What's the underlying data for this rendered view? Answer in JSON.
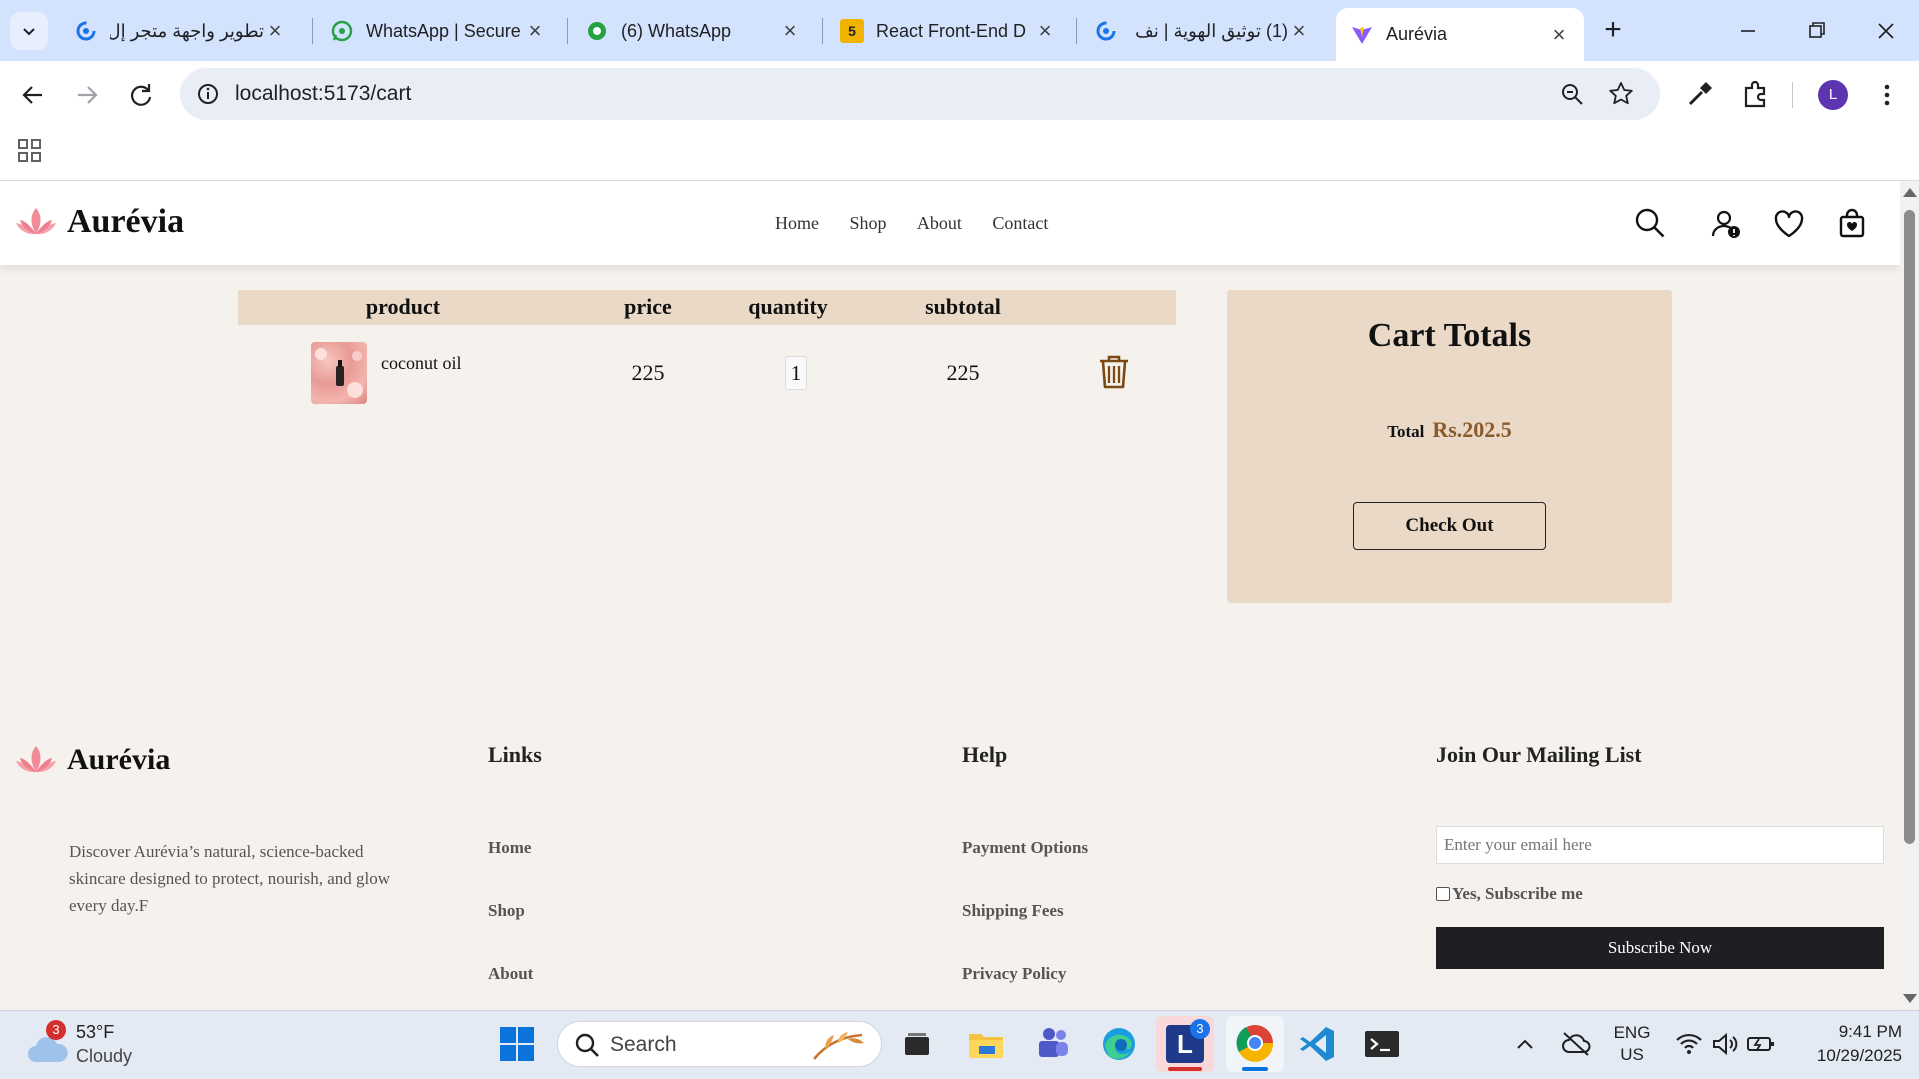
{
  "browser": {
    "tabs": [
      {
        "title": "تطوير واجهة متجر إل",
        "favicon": "blue-refresh-logo",
        "active": false
      },
      {
        "title": "WhatsApp | Secure",
        "favicon": "whatsapp-logo",
        "active": false
      },
      {
        "title": "(6) WhatsApp",
        "favicon": "whatsapp-logo",
        "active": false
      },
      {
        "title": "React Front-End D",
        "favicon": "numbered-5-logo",
        "active": false
      },
      {
        "title": "(1) توثيق الهوية | نف",
        "favicon": "blue-refresh-logo",
        "active": false
      },
      {
        "title": "Aurévia",
        "favicon": "vite-logo",
        "active": true
      }
    ],
    "five_badge": "5",
    "url": "localhost:5173/cart",
    "profile_initial": "L"
  },
  "site": {
    "brand": "Aurévia",
    "nav": [
      "Home",
      "Shop",
      "About",
      "Contact"
    ]
  },
  "cart": {
    "headers": {
      "product": "product",
      "price": "price",
      "quantity": "quantity",
      "subtotal": "subtotal"
    },
    "items": [
      {
        "name": "coconut oil",
        "price": "225",
        "quantity": "1",
        "subtotal": "225"
      }
    ]
  },
  "totals": {
    "title": "Cart Totals",
    "total_label": "Total",
    "total_value": "Rs.202.5",
    "checkout_label": "Check Out"
  },
  "footer": {
    "brand": "Aurévia",
    "description": "Discover Aurévia’s natural, science-backed skincare designed to protect, nourish, and glow every day.F",
    "links_title": "Links",
    "links": [
      "Home",
      "Shop",
      "About"
    ],
    "help_title": "Help",
    "help": [
      "Payment Options",
      "Shipping Fees",
      "Privacy Policy"
    ],
    "mailing_title": "Join Our Mailing List",
    "email_placeholder": "Enter your email here",
    "subscribe_checkbox_label": "Yes, Subscribe me",
    "subscribe_button": "Subscribe Now"
  },
  "taskbar": {
    "weather_temp": "53°F",
    "weather_desc": "Cloudy",
    "weather_badge": "3",
    "search_label": "Search",
    "app_badge": "3",
    "lang_line1": "ENG",
    "lang_line2": "US",
    "time": "9:41 PM",
    "date": "10/29/2025"
  },
  "colors": {
    "accent_beige": "#ead9c6",
    "background": "#f5f1ed",
    "total_value": "#8a5a2b",
    "trash": "#7a4a10",
    "tabbar": "#d3e3fd"
  }
}
